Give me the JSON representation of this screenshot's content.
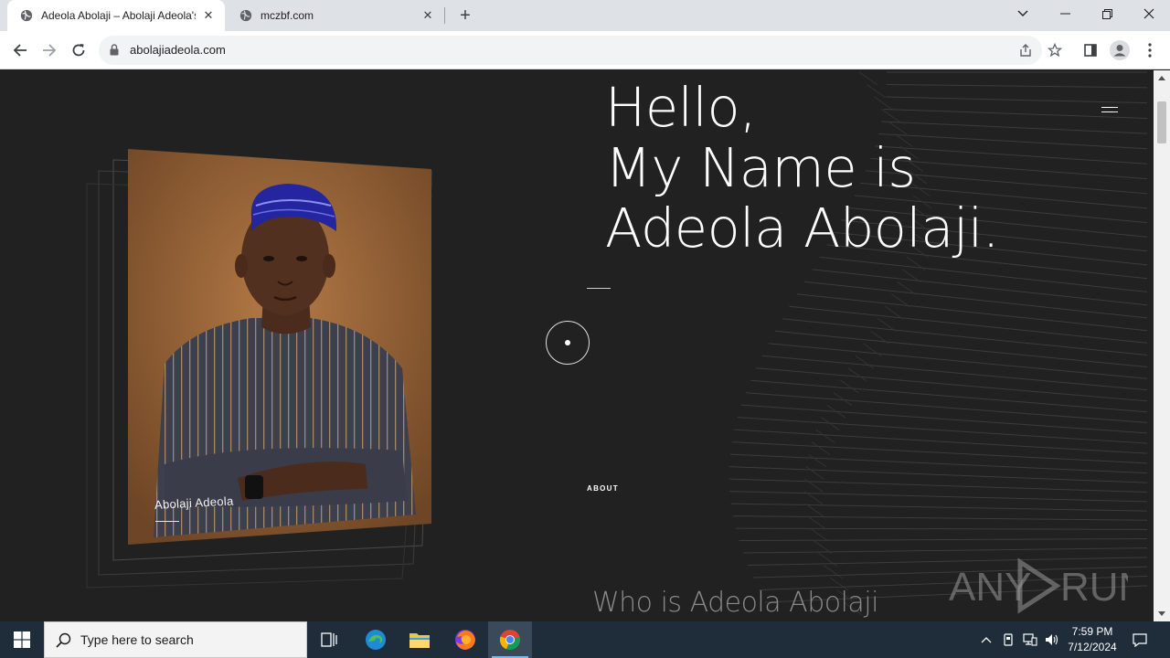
{
  "browser": {
    "tabs": [
      {
        "title": "Adeola Abolaji – Abolaji Adeola's",
        "active": true,
        "favicon": "globe-icon"
      },
      {
        "title": "mczbf.com",
        "active": false,
        "favicon": "globe-icon"
      }
    ],
    "new_tab_label": "+",
    "window_controls": [
      "chevron-down-icon",
      "minimize-icon",
      "restore-icon",
      "close-icon"
    ],
    "address": "abolajiadeola.com",
    "toolbar_icons": [
      "back-icon",
      "forward-icon",
      "reload-icon",
      "lock-icon",
      "share-icon",
      "star-icon",
      "side-panel-icon",
      "profile-icon",
      "kebab-menu-icon"
    ]
  },
  "page": {
    "hero": {
      "line1": "Hello,",
      "line2": "My Name is",
      "line3": "Adeola Abolaji."
    },
    "photo_caption": "Abolaji Adeola",
    "about_label": "ABOUT",
    "section_title": "Who is Adeola Abolaji",
    "colors": {
      "background": "#212121",
      "text": "#ffffff",
      "muted_heading": "#8a8a8a"
    }
  },
  "watermark": {
    "text_left": "ANY",
    "text_right": "RUN"
  },
  "taskbar": {
    "search_placeholder": "Type here to search",
    "apps": [
      "task-view-icon",
      "edge-icon",
      "file-explorer-icon",
      "firefox-icon",
      "chrome-icon"
    ],
    "tray_icons": [
      "chevron-up-icon",
      "usb-icon",
      "network-icon",
      "volume-icon",
      "notification-icon"
    ],
    "time": "7:59 PM",
    "date": "7/12/2024"
  }
}
